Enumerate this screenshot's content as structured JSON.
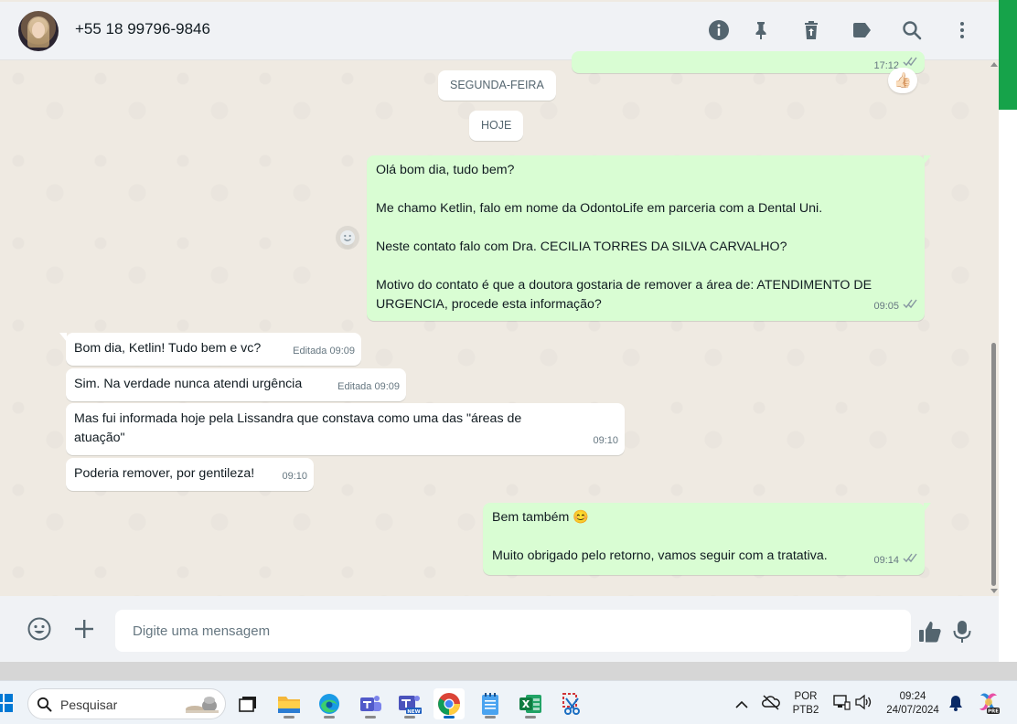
{
  "header": {
    "contact_name": "+55 18 99796-9846",
    "icons": [
      "info-icon",
      "pin-icon",
      "delete-icon",
      "label-icon",
      "search-icon",
      "menu-icon"
    ]
  },
  "chat": {
    "date_separators": [
      "SEGUNDA-FEIRA",
      "HOJE"
    ],
    "top_partial_message": {
      "time": "17:12",
      "reaction": "👍🏻"
    },
    "messages": [
      {
        "direction": "out",
        "paragraphs": [
          "Olá bom dia, tudo bem?",
          "Me chamo Ketlin, falo em nome da OdontoLife em parceria com a Dental Uni.",
          "Neste contato falo com Dra. CECILIA TORRES DA SILVA CARVALHO?",
          "Motivo do contato é que a doutora gostaria de remover a área de: ATENDIMENTO DE URGENCIA, procede esta informação?"
        ],
        "time": "09:05",
        "status": "read"
      },
      {
        "direction": "in",
        "text": "Bom dia, Ketlin! Tudo bem e vc?",
        "meta": "Editada 09:09"
      },
      {
        "direction": "in",
        "text": "Sim. Na verdade nunca atendi urgência",
        "meta": "Editada 09:09"
      },
      {
        "direction": "in",
        "text": "Mas fui informada hoje pela Lissandra que constava como uma das \"áreas de atuação\"",
        "meta": "09:10"
      },
      {
        "direction": "in",
        "text": "Poderia remover, por gentileza!",
        "meta": "09:10"
      },
      {
        "direction": "out",
        "paragraphs": [
          "Bem também 😊",
          "Muito obrigado pelo retorno, vamos seguir com a tratativa."
        ],
        "time": "09:14",
        "status": "read"
      }
    ]
  },
  "composer": {
    "placeholder": "Digite uma mensagem",
    "icons": [
      "emoji-icon",
      "plus-icon",
      "thumbs-up-icon",
      "microphone-icon"
    ]
  },
  "taskbar": {
    "search_placeholder": "Pesquisar",
    "apps": [
      "task-view",
      "file-explorer",
      "edge",
      "teams",
      "teams-new",
      "chrome",
      "notepad",
      "excel",
      "snipping-tool"
    ],
    "language_line1": "POR",
    "language_line2": "PTB2",
    "time": "09:24",
    "date": "24/07/2024"
  },
  "colors": {
    "accent_green": "#16a34a",
    "bubble_out": "#d9fdd3",
    "bubble_in": "#ffffff",
    "chat_bg": "#efeae2",
    "read_ticks": "#667781"
  }
}
